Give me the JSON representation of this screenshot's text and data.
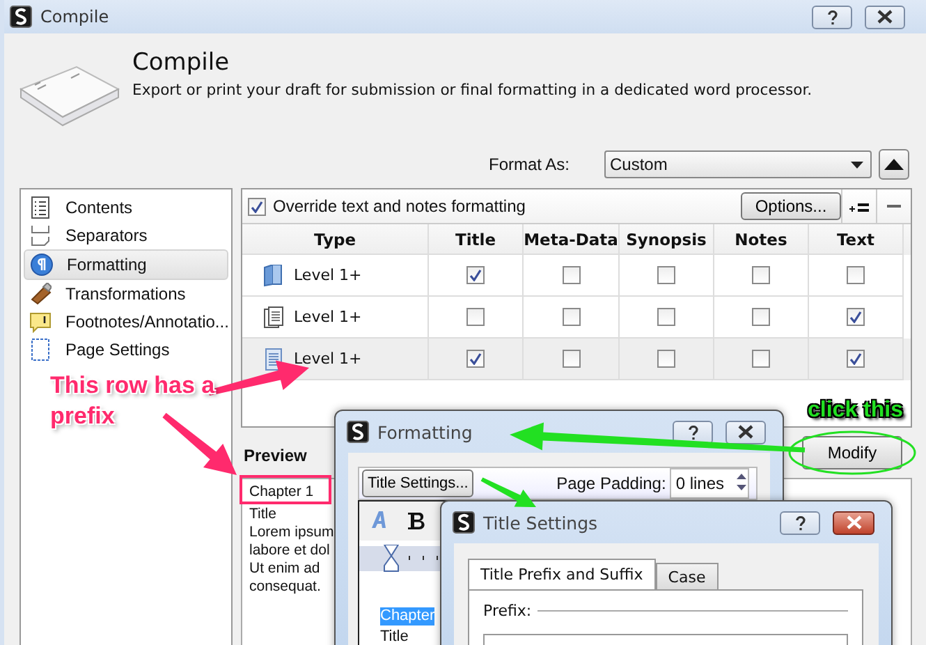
{
  "window": {
    "title": "Compile"
  },
  "header": {
    "title": "Compile",
    "subtitle": "Export or print your draft for submission or final formatting in a dedicated word processor."
  },
  "format_as": {
    "label": "Format As:",
    "value": "Custom"
  },
  "sidebar": {
    "items": [
      {
        "label": "Contents",
        "kind": "contents",
        "selected": false
      },
      {
        "label": "Separators",
        "kind": "separators",
        "selected": false
      },
      {
        "label": "Formatting",
        "kind": "formatting",
        "selected": true
      },
      {
        "label": "Transformations",
        "kind": "transformations",
        "selected": false
      },
      {
        "label": "Footnotes/Annotatio...",
        "kind": "footnotes",
        "selected": false
      },
      {
        "label": "Page Settings",
        "kind": "page",
        "selected": false
      }
    ]
  },
  "override": {
    "label": "Override text and notes formatting",
    "checked": true
  },
  "options_button": "Options...",
  "table": {
    "columns": [
      "Type",
      "Title",
      "Meta-Data",
      "Synopsis",
      "Notes",
      "Text"
    ],
    "rows": [
      {
        "type": "Level 1+",
        "kind": "folder",
        "selected": false,
        "checks": [
          true,
          false,
          false,
          false,
          false
        ]
      },
      {
        "type": "Level 1+",
        "kind": "stack",
        "selected": false,
        "checks": [
          false,
          false,
          false,
          false,
          true
        ]
      },
      {
        "type": "Level 1+",
        "kind": "document",
        "selected": true,
        "checks": [
          true,
          false,
          false,
          false,
          true
        ]
      }
    ]
  },
  "modify_button": "Modify",
  "preview": {
    "label": "Preview",
    "lines": [
      "Chapter 1",
      "Title",
      "Lorem ipsum",
      "labore et dol",
      "Ut enim ad",
      "consequat."
    ]
  },
  "formatting_dialog": {
    "title": "Formatting",
    "title_settings_button": "Title Settings...",
    "page_padding_label": "Page Padding:",
    "page_padding_value": "0 lines",
    "editor_lines": [
      {
        "text": "Chapter",
        "selected": true
      },
      {
        "text": "Title",
        "selected": false
      }
    ]
  },
  "title_settings_dialog": {
    "title": "Title Settings",
    "tabs": [
      {
        "label": "Title Prefix and Suffix",
        "selected": true
      },
      {
        "label": "Case",
        "selected": false
      }
    ],
    "prefix_label": "Prefix:"
  },
  "annotations": [
    {
      "text": "This row has a prefix",
      "color": "#ff2a6d"
    },
    {
      "text": "click this",
      "color": "#22e022"
    }
  ]
}
